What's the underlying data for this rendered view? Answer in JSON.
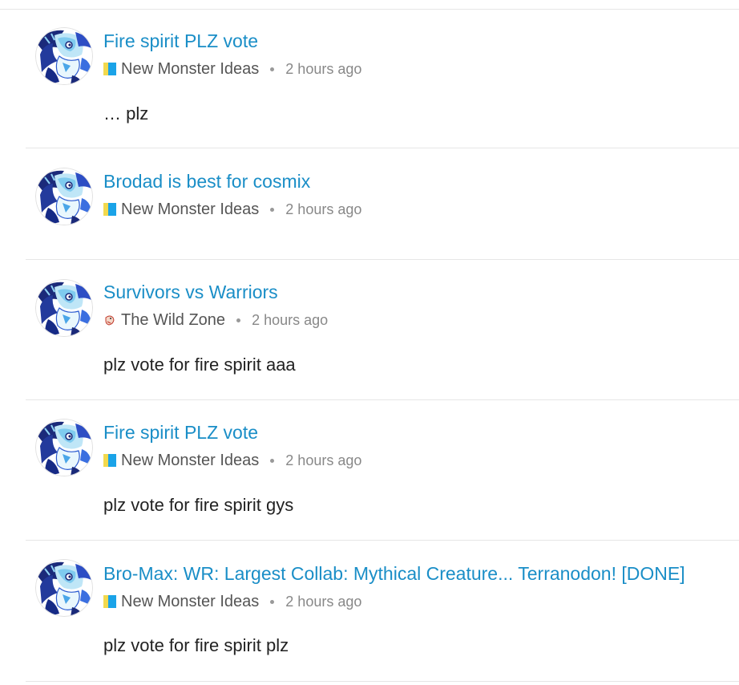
{
  "posts": [
    {
      "title": "Fire spirit PLZ vote",
      "category": "New Monster Ideas",
      "category_icon": "yellow-blue-category-icon",
      "time": "2 hours ago",
      "excerpt": "… plz"
    },
    {
      "title": "Brodad is best for cosmix",
      "category": "New Monster Ideas",
      "category_icon": "yellow-blue-category-icon",
      "time": "2 hours ago",
      "excerpt": ""
    },
    {
      "title": "Survivors vs Warriors",
      "category": "The Wild Zone",
      "category_icon": "wild-zone-category-icon",
      "time": "2 hours ago",
      "excerpt": "plz vote for fire spirit aaa"
    },
    {
      "title": "Fire spirit PLZ vote",
      "category": "New Monster Ideas",
      "category_icon": "yellow-blue-category-icon",
      "time": "2 hours ago",
      "excerpt": "plz vote for fire spirit gys"
    },
    {
      "title": "Bro-Max: WR: Largest Collab: Mythical Creature... Terranodon! [DONE]",
      "category": "New Monster Ideas",
      "category_icon": "yellow-blue-category-icon",
      "time": "2 hours ago",
      "excerpt": "plz vote for fire spirit plz"
    }
  ],
  "colors": {
    "title_link": "#1a8ec7",
    "category_text": "#555555",
    "time_text": "#888888",
    "excerpt_text": "#222222",
    "divider": "#e6e6e6",
    "category_yellow": "#f2d94e",
    "category_blue": "#1aa3e8"
  }
}
